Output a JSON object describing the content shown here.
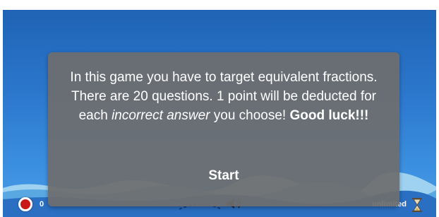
{
  "dialog": {
    "message_part1": "In this game you have to target equivalent fractions. There are 20 questions. 1 point will be deducted for each",
    "message_italic": "incorrect answer",
    "message_part2": "you choose!",
    "message_bold": "Good luck!!!",
    "start_label": "Start"
  },
  "hud": {
    "score": "0",
    "timer_label": "unlimited",
    "lives_icon": "red-circle-icon",
    "sound_icon": "speaker-icon",
    "timer_icon": "hourglass-icon"
  },
  "colors": {
    "background_top": "#1f63b4",
    "background_bottom": "#4a9de4",
    "dialog": "#6e6e6e",
    "lives": "#c81818"
  }
}
